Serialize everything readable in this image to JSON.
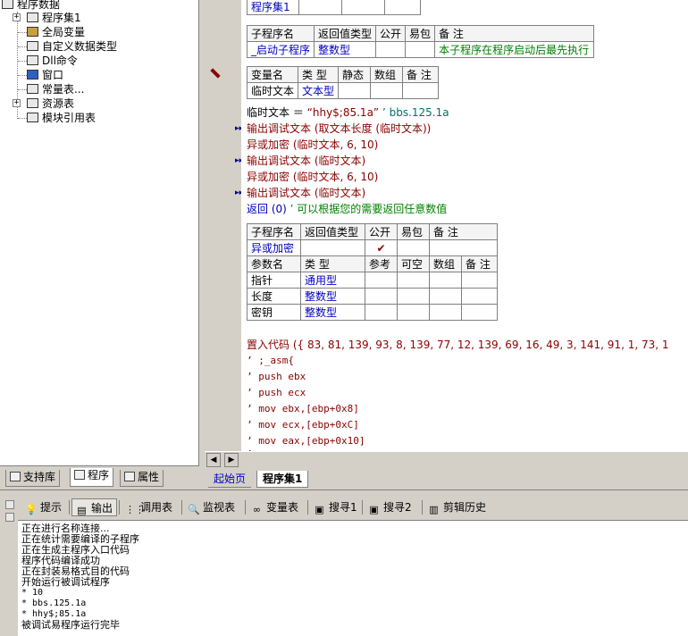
{
  "tree": {
    "root": "程序数据",
    "items": [
      {
        "label": "程序集1",
        "icon": "program-set-icon",
        "expander": "+"
      },
      {
        "label": "全局变量",
        "icon": "global-var-icon"
      },
      {
        "label": "自定义数据类型",
        "icon": "custom-type-icon"
      },
      {
        "label": "Dll命令",
        "icon": "dll-icon"
      },
      {
        "label": "窗口",
        "icon": "window-icon"
      },
      {
        "label": "常量表...",
        "icon": "const-icon"
      },
      {
        "label": "资源表",
        "icon": "resource-icon",
        "expander": "+"
      },
      {
        "label": "模块引用表",
        "icon": "module-icon"
      }
    ]
  },
  "left_tabs": [
    "支持库",
    "程序",
    "属性"
  ],
  "code": {
    "prog_set_table": {
      "cell": "程序集1"
    },
    "sub1": {
      "headers": [
        "子程序名",
        "返回值类型",
        "公开",
        "易包",
        "备 注"
      ],
      "row": [
        "_启动子程序",
        "整数型",
        "",
        "",
        "本子程序在程序启动后最先执行"
      ]
    },
    "vars": {
      "headers": [
        "变量名",
        "类 型",
        "静态",
        "数组",
        "备 注"
      ],
      "row": [
        "临时文本",
        "文本型",
        "",
        "",
        ""
      ]
    },
    "lines": [
      {
        "a": "临时文本 ＝ ",
        "b": "“hhy$;85.1a”",
        "c": "  ’ bbs.125.1a"
      },
      {
        "a": "输出调试文本 (",
        "b": "取文本长度 (临时文本))",
        "c": ""
      },
      {
        "a": "异或加密 (临时文本, 6, 10)",
        "b": "",
        "c": ""
      },
      {
        "a": "输出调试文本 (临时文本)",
        "b": "",
        "c": ""
      },
      {
        "a": "异或加密 (临时文本, 6, 10)",
        "b": "",
        "c": ""
      },
      {
        "a": "输出调试文本 (临时文本)",
        "b": "",
        "c": ""
      },
      {
        "a": "返回 (0)",
        "b": "  ’ 可以根据您的需要返回任意数值",
        "c": ""
      }
    ],
    "sub2": {
      "headers": [
        "子程序名",
        "返回值类型",
        "公开",
        "易包",
        "备 注"
      ],
      "row": [
        "异或加密",
        "",
        "✔",
        "",
        ""
      ],
      "param_headers": [
        "参数名",
        "类 型",
        "参考",
        "可空",
        "数组",
        "备 注"
      ],
      "params": [
        [
          "指针",
          "通用型"
        ],
        [
          "长度",
          "整数型"
        ],
        [
          "密钥",
          "整数型"
        ]
      ]
    },
    "asm": [
      "置入代码 ({ 83, 81, 139, 93, 8, 139, 77, 12, 139, 69, 16, 49, 3, 141, 91, 1, 73, 1",
      "’ ;_asm{",
      "’ push ebx",
      "’ push ecx",
      "’ mov ebx,[ebp+0x8]",
      "’ mov ecx,[ebp+0xC]",
      "’ mov eax,[ebp+0x10]",
      "’"
    ]
  },
  "editor_tabs": [
    "起始页",
    "程序集1"
  ],
  "tools": [
    "提示",
    "输出",
    "调用表",
    "监视表",
    "变量表",
    "搜寻1",
    "搜寻2",
    "剪辑历史"
  ],
  "output": [
    "正在进行名称连接...",
    "正在统计需要编译的子程序",
    "正在生成主程序入口代码",
    "程序代码编译成功",
    "正在封装易格式目的代码",
    "开始运行被调试程序",
    "* 10",
    "* bbs.125.1a",
    "* hhy$;85.1a",
    "被调试易程序运行完毕"
  ]
}
